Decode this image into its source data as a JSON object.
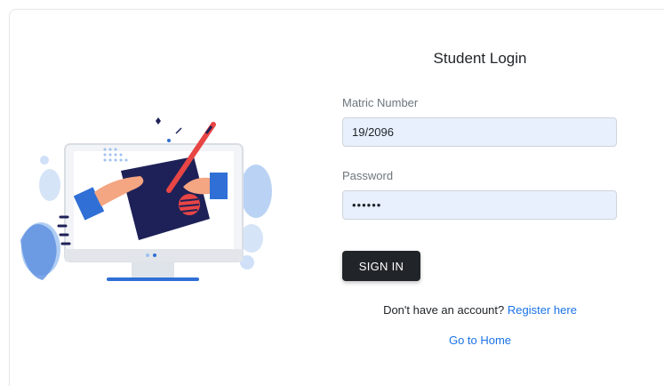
{
  "login": {
    "title": "Student Login",
    "matric_label": "Matric Number",
    "matric_value": "19/2096",
    "password_label": "Password",
    "password_value": "123456",
    "signin_label": "SIGN IN",
    "register_prompt": "Don't have an account?",
    "register_link": "Register here",
    "home_link": "Go to Home"
  },
  "illustration": {
    "icon": "laptop-signing-illustration",
    "colors": {
      "navy": "#1e2157",
      "blue": "#2f6fd6",
      "light_blue": "#9cc0f0",
      "red": "#e84545",
      "skin": "#f4a582",
      "screen": "#e8edf3"
    }
  },
  "colors": {
    "accent_link": "#1a73e8",
    "button_bg": "#212529",
    "input_bg": "#e8f0fe"
  }
}
